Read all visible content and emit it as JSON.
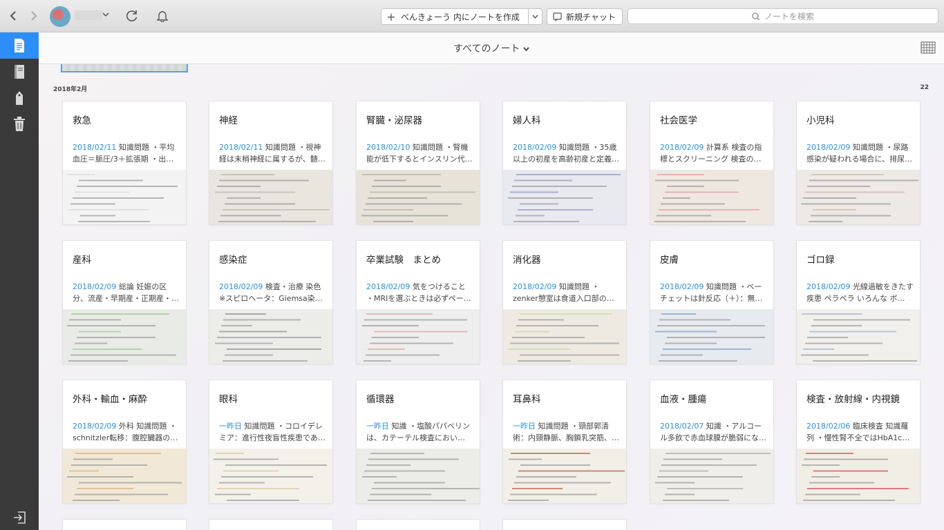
{
  "toolbar": {
    "back_icon": "chevron-left-icon",
    "forward_icon": "chevron-right-icon",
    "new_note_label": "べんきょーう 内にノートを作成",
    "new_chat_label": "新規チャット",
    "search_placeholder": "ノートを検索"
  },
  "sidebar": {
    "items": [
      "notes-icon",
      "notebooks-icon",
      "tags-icon",
      "trash-icon"
    ],
    "bottom": "sign-out-icon"
  },
  "header": {
    "title": "すべてのノート"
  },
  "section": {
    "label": "2018年2月",
    "count": "22"
  },
  "notes": [
    {
      "title": "救急",
      "date": "2018/02/11",
      "snippet": " 知識問題 ・平均血圧＝脈圧/3＋拡張期 ・出血…",
      "thumb": [
        "#f3f3f3",
        "#d7d7d7"
      ]
    },
    {
      "title": "神経",
      "date": "2018/02/11",
      "snippet": " 知識問題 ・視神経は末梢神経に属するが、髄鞘…",
      "thumb": [
        "#e9e6e0",
        "#b9b6b0"
      ]
    },
    {
      "title": "腎臓・泌尿器",
      "date": "2018/02/10",
      "snippet": " 知識問題 ・腎機能が低下するとインスリン代謝…",
      "thumb": [
        "#e7e3d9",
        "#b7b2a6"
      ]
    },
    {
      "title": "婦人科",
      "date": "2018/02/09",
      "snippet": " 知識問題 ・35歳以上の初産を高齢初産と定義す…",
      "thumb": [
        "#e8eaf0",
        "#8e94c4"
      ]
    },
    {
      "title": "社会医学",
      "date": "2018/02/09",
      "snippet": " 計算系 検査の指標とスクリーニング 検査の結…",
      "thumb": [
        "#efe8e1",
        "#e39aa8"
      ]
    },
    {
      "title": "小児科",
      "date": "2018/02/09",
      "snippet": " 知識問題 ・尿路感染が疑われる場合に、排尿時…",
      "thumb": [
        "#ede9e4",
        "#c9b7b2"
      ]
    },
    {
      "title": "産科",
      "date": "2018/02/09",
      "snippet": " 総論 妊娠の区分、流産・早期産・正期産・過…",
      "thumb": [
        "#e9ebe6",
        "#9bc59b"
      ]
    },
    {
      "title": "感染症",
      "date": "2018/02/09",
      "snippet": " 検査・治療 染色 ※スピロヘータ：Giemsa染色…",
      "thumb": [
        "#ecece9",
        "#8d8d8d"
      ]
    },
    {
      "title": "卒業試験　まとめ",
      "date": "2018/02/09",
      "snippet": " 気をつけること ・MRIを選ぶときは必ずペー…",
      "thumb": [
        "#eeeeee",
        "#e0a0a0"
      ]
    },
    {
      "title": "消化器",
      "date": "2018/02/09",
      "snippet": " 知識問題 ・zenker憩室は食道入口部の憩…",
      "thumb": [
        "#eeeae2",
        "#c8d9a8"
      ]
    },
    {
      "title": "皮膚",
      "date": "2018/02/09",
      "snippet": " 知識問題 ・ベーチェットは針反応（＋）：無菌…",
      "thumb": [
        "#e7eaee",
        "#7f9fc8"
      ]
    },
    {
      "title": "ゴロ録",
      "date": "2018/02/09",
      "snippet": " 光線過敏をきたす疾患 ペラペラ いろんな ボ…",
      "thumb": [
        "#f2f0ec",
        "#a0b0c8"
      ]
    },
    {
      "title": "外科・輸血・麻酔",
      "date": "2018/02/09",
      "snippet": " 外科 知識問題 ・schnitzler転移：腹腔臓器の原…",
      "thumb": [
        "#f1e8d8",
        "#d7b27a"
      ]
    },
    {
      "title": "眼科",
      "date": "一昨日",
      "snippet": " 知識問題 ・コロイデレミア：進行性夜盲性疾患であり…",
      "thumb": [
        "#f3f1ea",
        "#d9c7a0"
      ]
    },
    {
      "title": "循環器",
      "date": "一昨日",
      "snippet": " 知識 ・塩酸パパベリンは、カテーテル検査において、…",
      "thumb": [
        "#ecece8",
        "#a0a0a0"
      ]
    },
    {
      "title": "耳鼻科",
      "date": "一昨日",
      "snippet": " 知識問題 ・頸部郭清術：内頸静脈、胸鎖乳突筋、副…",
      "thumb": [
        "#f2efe8",
        "#b86040"
      ]
    },
    {
      "title": "血液・腫瘍",
      "date": "2018/02/07",
      "snippet": " 知識 ・アルコール多飲で赤血球膜が脆弱になり…",
      "thumb": [
        "#efeeea",
        "#a8a8a8"
      ]
    },
    {
      "title": "検査・放射線・内視鏡",
      "date": "2018/02/06",
      "snippet": " 臨床検査 知識羅列 ・慢性腎不全ではHbA1cが…",
      "thumb": [
        "#f1eee6",
        "#d04a5a"
      ]
    }
  ]
}
